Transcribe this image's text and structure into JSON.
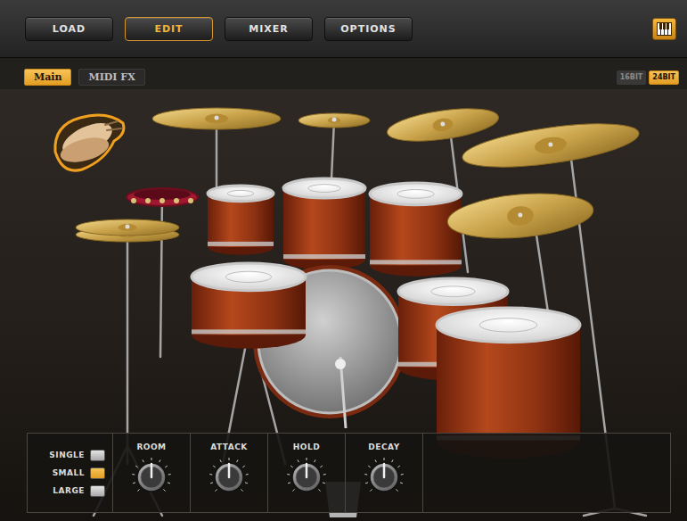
{
  "toolbar": {
    "buttons": [
      {
        "label": "LOAD",
        "selected": false
      },
      {
        "label": "EDIT",
        "selected": true
      },
      {
        "label": "MIXER",
        "selected": false
      },
      {
        "label": "OPTIONS",
        "selected": false
      }
    ]
  },
  "tabs": [
    {
      "label": "Main",
      "selected": true
    },
    {
      "label": "MIDI FX",
      "selected": false
    }
  ],
  "bit_depth": [
    {
      "label": "16BIT",
      "selected": false
    },
    {
      "label": "24BIT",
      "selected": true
    }
  ],
  "room_size": [
    {
      "label": "SINGLE",
      "selected": false
    },
    {
      "label": "SMALL",
      "selected": true
    },
    {
      "label": "LARGE",
      "selected": false
    }
  ],
  "knobs": [
    {
      "label": "ROOM",
      "level": 0.5
    },
    {
      "label": "ATTACK",
      "level": 0.5
    },
    {
      "label": "HOLD",
      "level": 0.5
    },
    {
      "label": "DECAY",
      "level": 0.5
    }
  ]
}
